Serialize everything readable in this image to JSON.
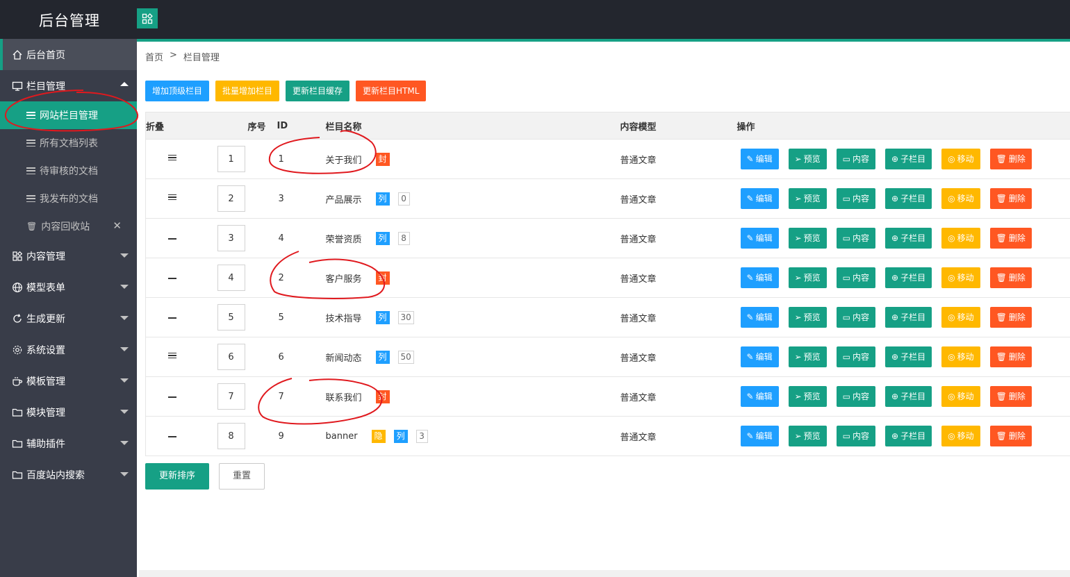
{
  "app": {
    "title": "后台管理"
  },
  "sidebar": {
    "home": "后台首页",
    "column_mgmt": "栏目管理",
    "sub_items": [
      "网站栏目管理",
      "所有文档列表",
      "待审核的文档",
      "我发布的文档",
      "内容回收站"
    ],
    "sections": [
      "内容管理",
      "模型表单",
      "生成更新",
      "系统设置",
      "模板管理",
      "模块管理",
      "辅助插件",
      "百度站内搜索"
    ]
  },
  "breadcrumb": {
    "home": "首页",
    "sep": ">",
    "current": "栏目管理"
  },
  "toolbar": {
    "add_top": "增加顶级栏目",
    "batch_add": "批量增加栏目",
    "refresh_cache": "更新栏目缓存",
    "refresh_html": "更新栏目HTML"
  },
  "table": {
    "headers": {
      "fold": "折叠",
      "sort": "序号",
      "id": "ID",
      "name": "栏目名称",
      "model": "内容模型",
      "ops": "操作"
    },
    "rows": [
      {
        "fold": "lines",
        "sort": "1",
        "id": "1",
        "name": "关于我们",
        "tags": [
          {
            "text": "封",
            "color": "orange"
          }
        ],
        "count": "",
        "model": "普通文章"
      },
      {
        "fold": "lines",
        "sort": "2",
        "id": "3",
        "name": "产品展示",
        "tags": [
          {
            "text": "列",
            "color": "blue"
          }
        ],
        "count": "0",
        "model": "普通文章"
      },
      {
        "fold": "dash",
        "sort": "3",
        "id": "4",
        "name": "荣誉资质",
        "tags": [
          {
            "text": "列",
            "color": "blue"
          }
        ],
        "count": "8",
        "model": "普通文章"
      },
      {
        "fold": "dash",
        "sort": "4",
        "id": "2",
        "name": "客户服务",
        "tags": [
          {
            "text": "封",
            "color": "orange"
          }
        ],
        "count": "",
        "model": "普通文章"
      },
      {
        "fold": "dash",
        "sort": "5",
        "id": "5",
        "name": "技术指导",
        "tags": [
          {
            "text": "列",
            "color": "blue"
          }
        ],
        "count": "30",
        "model": "普通文章"
      },
      {
        "fold": "lines",
        "sort": "6",
        "id": "6",
        "name": "新闻动态",
        "tags": [
          {
            "text": "列",
            "color": "blue"
          }
        ],
        "count": "50",
        "model": "普通文章"
      },
      {
        "fold": "dash",
        "sort": "7",
        "id": "7",
        "name": "联系我们",
        "tags": [
          {
            "text": "封",
            "color": "orange"
          }
        ],
        "count": "",
        "model": "普通文章"
      },
      {
        "fold": "dash",
        "sort": "8",
        "id": "9",
        "name": "banner",
        "tags": [
          {
            "text": "隐",
            "color": "yellow"
          },
          {
            "text": "列",
            "color": "blue"
          }
        ],
        "count": "3",
        "model": "普通文章"
      }
    ],
    "ops": [
      {
        "label": "编辑",
        "icon": "pencil-icon",
        "glyph": "✎",
        "color": "blue"
      },
      {
        "label": "预览",
        "icon": "send-icon",
        "glyph": "➢",
        "color": "green"
      },
      {
        "label": "内容",
        "icon": "folder-icon",
        "glyph": "▭",
        "color": "green"
      },
      {
        "label": "子栏目",
        "icon": "add-circle-icon",
        "glyph": "⊕",
        "color": "green"
      },
      {
        "label": "移动",
        "icon": "move-icon",
        "glyph": "◎",
        "color": "yellow"
      },
      {
        "label": "删除",
        "icon": "trash-icon",
        "glyph": "🗑",
        "color": "red"
      }
    ]
  },
  "actions": {
    "update_sort": "更新排序",
    "reset": "重置"
  },
  "colors": {
    "accent": "#16a085",
    "blue": "#1e9fff",
    "yellow": "#ffb800",
    "red": "#ff5722",
    "sidebar": "#393d49",
    "topbar": "#23262e"
  }
}
